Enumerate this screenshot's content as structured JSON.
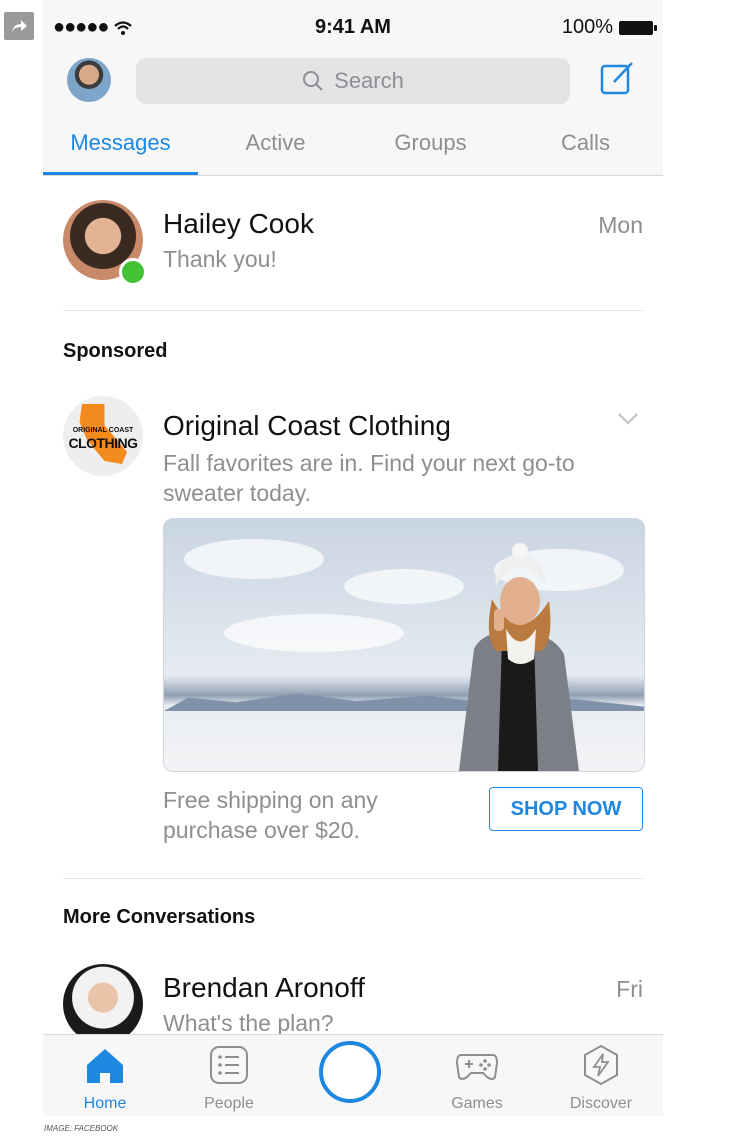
{
  "status": {
    "signal": "●●●●●",
    "time": "9:41 AM",
    "battery": "100%"
  },
  "search": {
    "placeholder": "Search"
  },
  "tabs": [
    {
      "label": "Messages",
      "active": true
    },
    {
      "label": "Active",
      "active": false
    },
    {
      "label": "Groups",
      "active": false
    },
    {
      "label": "Calls",
      "active": false
    }
  ],
  "conversations": [
    {
      "name": "Hailey Cook",
      "preview": "Thank you!",
      "time": "Mon",
      "online": true
    }
  ],
  "sponsored": {
    "section_title": "Sponsored",
    "brand_name": "Original Coast Clothing",
    "logo_text_top": "ORIGINAL COAST",
    "logo_text_bottom": "CLOTHING",
    "message": "Fall favorites are in. Find your next go-to sweater today.",
    "cta_text": "Free shipping on any purchase over $20.",
    "button_label": "SHOP NOW"
  },
  "more": {
    "section_title": "More Conversations",
    "items": [
      {
        "name": "Brendan Aronoff",
        "preview": "What's the plan?",
        "time": "Fri"
      }
    ]
  },
  "tabbar": [
    {
      "label": "Home",
      "icon": "home-icon",
      "active": true
    },
    {
      "label": "People",
      "icon": "people-list-icon",
      "active": false
    },
    {
      "label": "",
      "icon": "camera-circle-icon",
      "active": false
    },
    {
      "label": "Games",
      "icon": "gamepad-icon",
      "active": false
    },
    {
      "label": "Discover",
      "icon": "discover-icon",
      "active": false
    }
  ],
  "credit": "IMAGE: FACEBOOK",
  "colors": {
    "accent": "#1e87e0",
    "online": "#42c234",
    "brand_orange": "#f28a1e",
    "muted": "#8e8e93"
  }
}
